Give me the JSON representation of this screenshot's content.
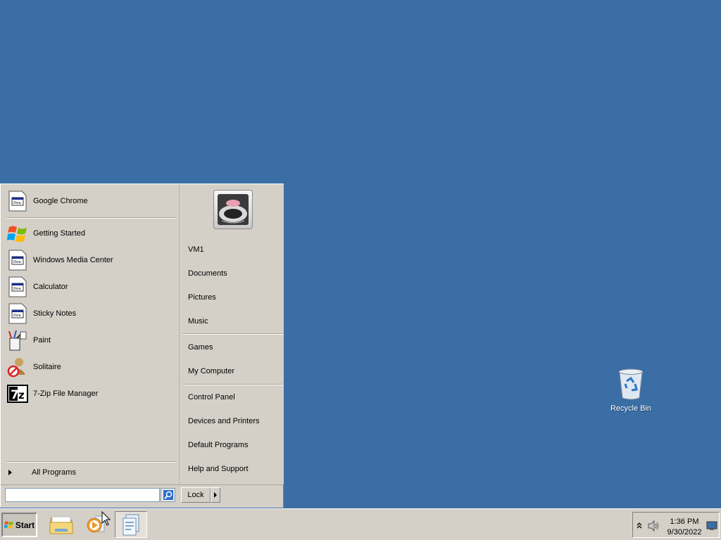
{
  "desktop": {
    "recycle_bin_label": "Recycle Bin"
  },
  "start_menu": {
    "pinned": [
      {
        "label": "Google Chrome",
        "icon": "generic-app-icon"
      }
    ],
    "recent": [
      {
        "label": "Getting Started",
        "icon": "windows-flag-icon"
      },
      {
        "label": "Windows Media Center",
        "icon": "generic-app-icon"
      },
      {
        "label": "Calculator",
        "icon": "generic-app-icon"
      },
      {
        "label": "Sticky Notes",
        "icon": "generic-app-icon"
      },
      {
        "label": "Paint",
        "icon": "paint-icon"
      },
      {
        "label": "Solitaire",
        "icon": "solitaire-icon"
      },
      {
        "label": "7-Zip File Manager",
        "icon": "7zip-icon"
      }
    ],
    "all_programs": "All Programs",
    "search_placeholder": "",
    "places": {
      "user": "VM1",
      "documents": "Documents",
      "pictures": "Pictures",
      "music": "Music",
      "games": "Games",
      "computer": "My Computer",
      "control_panel": "Control Panel",
      "devices": "Devices and Printers",
      "defaults": "Default Programs",
      "help": "Help and Support"
    },
    "lock_label": "Lock"
  },
  "taskbar": {
    "start_label": "Start",
    "clock_time": "1:36 PM",
    "clock_date": "9/30/2022"
  },
  "colors": {
    "desktop": "#3b6ea5",
    "menu_bg": "#d4d0c8"
  }
}
